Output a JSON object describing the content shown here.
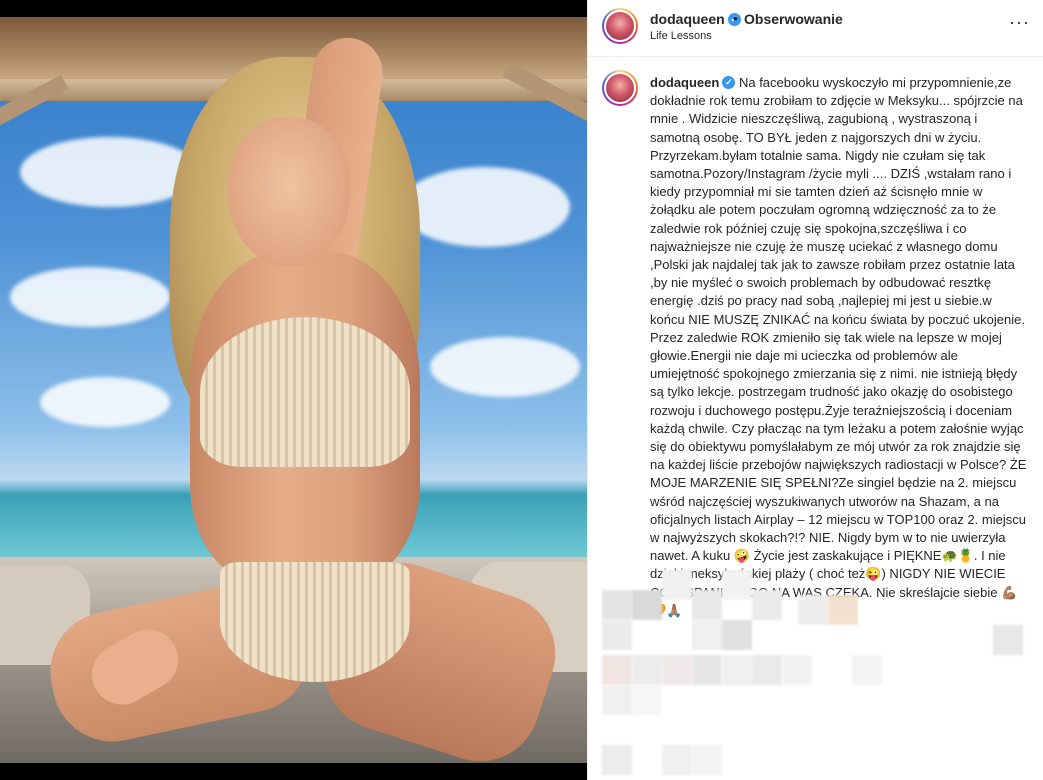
{
  "post": {
    "username": "dodaqueen",
    "verified_icon": "verified-badge-icon",
    "separator": "•",
    "follow_label": "Obserwowanie",
    "subtitle": "Life Lessons",
    "more_icon": "more-options-icon",
    "more_glyph": "···"
  },
  "caption": {
    "username": "dodaqueen",
    "text": "Na facebooku wyskoczyło mi przypomnienie,ze dokładnie rok temu zrobiłam to zdjęcie w Meksyku... spójrzcie na mnie . Widzicie nieszczęśliwą, zagubioną , wystraszoną i samotną osobę. TO BYŁ jeden z najgorszych dni w życiu. Przyrzekam.byłam totalnie sama. Nigdy nie czułam się tak samotna.Pozory/Instagram /życie myli .... DZIŚ ,wstałam rano i kiedy przypomniał mi sie tamten dzień aż ścisnęło mnie w żołądku ale potem poczułam ogromną wdzięczność za to że zaledwie rok później czuję się spokojna,szczęśliwa i co najważniejsze nie czuję że muszę uciekać z własnego domu ,Polski jak najdalej tak jak to zawsze robiłam przez ostatnie lata ,by nie myśleć o swoich problemach by odbudować resztkę energię .dziś po pracy nad sobą ,najlepiej mi jest u siebie.w końcu NIE MUSZĘ ZNIKAĆ na końcu świata by poczuć ukojenie. Przez zaledwie ROK zmieniło się tak wiele na lepsze w mojej głowie.Energii nie daje mi ucieczka od problemów ale umiejętność spokojnego zmierzania się z nimi. nie istnieją błędy są tylko lekcje. postrzegam trudność jako okazję do osobistego rozwoju i duchowego postępu.Żyje teraźniejszością i doceniam każdą chwile. Czy płacząc na tym leżaku a potem załośnie wyjąc się do obiektywu pomyślałabym ze mój utwór za rok znajdzie się na każdej liście przebojów największych radiostacji w Polsce? ŻE MOJE MARZENIE SIĘ SPEŁNI?Ze singiel będzie na 2. miejscu wśród najczęściej wyszukiwanych utworów na Shazam, a na oficjalnych listach Airplay – 12 miejscu w TOP100 oraz 2. miejscu w najwyższych skokach?!? NIE. Nigdy bym w to nie uwierzyła nawet. A kuku 🤪 Życie jest zaskakujące i PIĘKNE🐢🍍. I nie dzięki meksykańskiej plaży ( choć też😜) NIGDY NIE WIECIE CO WSPANIAŁEGO NA WAS CZEKA. Nie skreślajcie siebie 💪🏽🧡🙏🏽"
  },
  "colors": {
    "verified": "#3897f0",
    "text": "#262626",
    "border": "#efefef"
  }
}
